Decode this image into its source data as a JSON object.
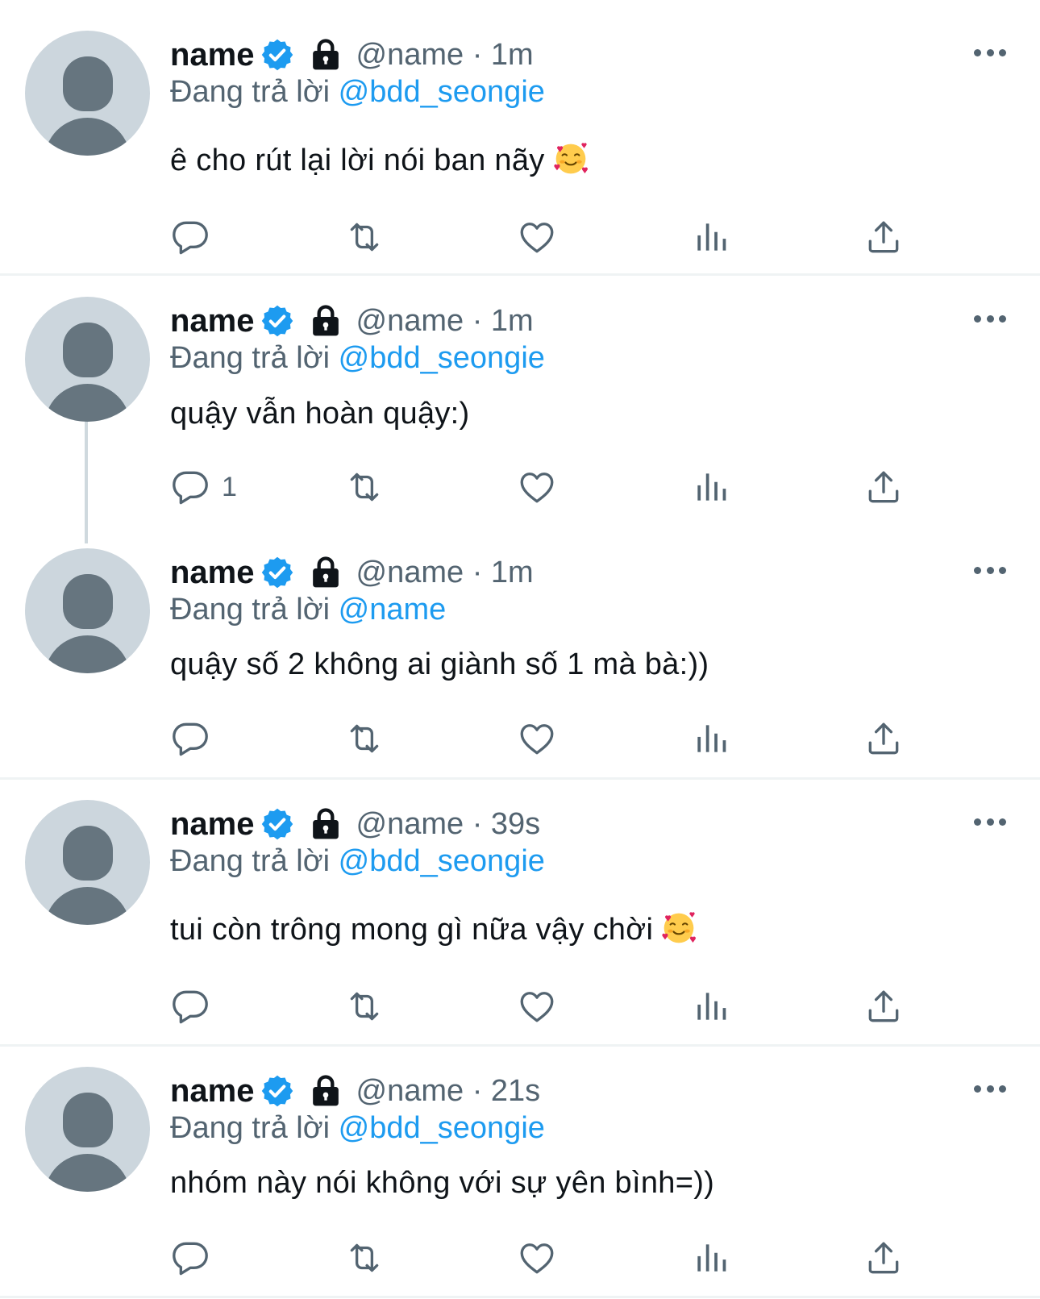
{
  "colors": {
    "link": "#1d9bf0",
    "secondary": "#536471",
    "verified": "#1d9bf0"
  },
  "tweets": [
    {
      "name": "name",
      "meta": "@name · 1m",
      "reply_prefix": "Đang trả lời",
      "reply_to": "@bdd_seongie",
      "text": "ê cho rút lại lời nói ban nãy",
      "has_emoji": true,
      "reply_count": ""
    },
    {
      "name": "name",
      "meta": "@name · 1m",
      "reply_prefix": "Đang trả lời",
      "reply_to": "@bdd_seongie",
      "text": "quậy vẫn hoàn quậy:)",
      "has_emoji": false,
      "reply_count": "1"
    },
    {
      "name": "name",
      "meta": "@name · 1m",
      "reply_prefix": "Đang trả lời",
      "reply_to": "@name",
      "text": "quậy số 2 không ai giành số 1 mà bà:))",
      "has_emoji": false,
      "reply_count": ""
    },
    {
      "name": "name",
      "meta": "@name · 39s",
      "reply_prefix": "Đang trả lời",
      "reply_to": "@bdd_seongie",
      "text": "tui còn trông mong gì nữa vậy chời",
      "has_emoji": true,
      "reply_count": ""
    },
    {
      "name": "name",
      "meta": "@name · 21s",
      "reply_prefix": "Đang trả lời",
      "reply_to": "@bdd_seongie",
      "text": "nhóm này nói không với sự yên bình=))",
      "has_emoji": false,
      "reply_count": ""
    }
  ],
  "icons": [
    "reply-icon",
    "retweet-icon",
    "like-icon",
    "views-icon",
    "share-icon",
    "more-icon",
    "verified-badge-icon",
    "lock-icon",
    "smiling-face-with-hearts-emoji"
  ]
}
